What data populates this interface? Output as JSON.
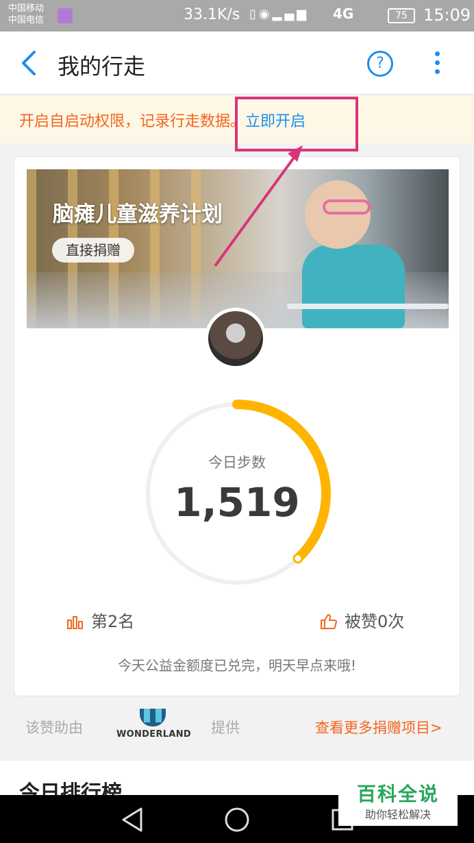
{
  "status_bar": {
    "carrier_1": "中国移动",
    "carrier_2": "中国电信",
    "speed": "33.1K/s",
    "icons": [
      "vibrate-icon",
      "eye-icon",
      "signal-2g-icon",
      "signal-4g-icon"
    ],
    "network_1": "4G",
    "battery": "75",
    "time": "15:09"
  },
  "header": {
    "title": "我的行走",
    "help_label": "?"
  },
  "notice": {
    "text": "开启自启动权限，记录行走数据。",
    "link": "立即开启"
  },
  "banner": {
    "title": "脑瘫儿童滋养计划",
    "button": "直接捐赠"
  },
  "steps": {
    "label": "今日步数",
    "value": "1,519",
    "progress": 0.38
  },
  "stats": {
    "rank": "第2名",
    "likes": "被赞0次"
  },
  "card_message": "今天公益金额度已兑完，明天早点来哦!",
  "sponsor": {
    "prefix": "该赞助由",
    "brand": "WONDERLAND",
    "suffix": "提供",
    "more_link": "查看更多捐赠项目>"
  },
  "ranking": {
    "title": "今日排行榜"
  },
  "watermark": {
    "title": "百科全说",
    "subtitle": "助你轻松解决"
  },
  "colors": {
    "accent": "#1d8ded",
    "orange": "#f4651f",
    "ring_progress": "#ffb400",
    "annotation": "#d9347a"
  }
}
